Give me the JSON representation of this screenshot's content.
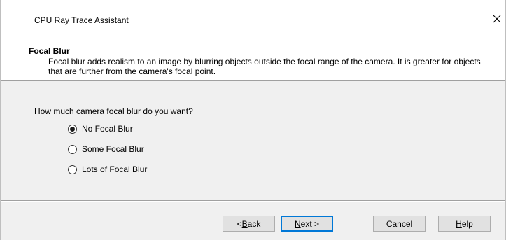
{
  "window": {
    "title": "CPU Ray Trace Assistant",
    "close_glyph": "✕"
  },
  "header": {
    "title": "Focal Blur",
    "description": "Focal blur adds realism to an image by blurring objects outside the focal range of the camera.  It is greater for objects that are further from the camera's focal point."
  },
  "question": {
    "label": "How much camera focal blur do you want?",
    "options": [
      {
        "label": "No Focal Blur",
        "checked": true
      },
      {
        "label": "Some Focal Blur",
        "checked": false
      },
      {
        "label": "Lots of Focal Blur",
        "checked": false
      }
    ]
  },
  "buttons": {
    "back": {
      "prefix": "< ",
      "mnemonic": "B",
      "rest": "ack"
    },
    "next": {
      "mnemonic": "N",
      "rest": "ext >"
    },
    "cancel": "Cancel",
    "help": {
      "mnemonic": "H",
      "rest": "elp"
    }
  },
  "colors": {
    "accent": "#0078d7",
    "dialog_bg": "#f0f0f0",
    "header_bg": "#ffffff"
  }
}
